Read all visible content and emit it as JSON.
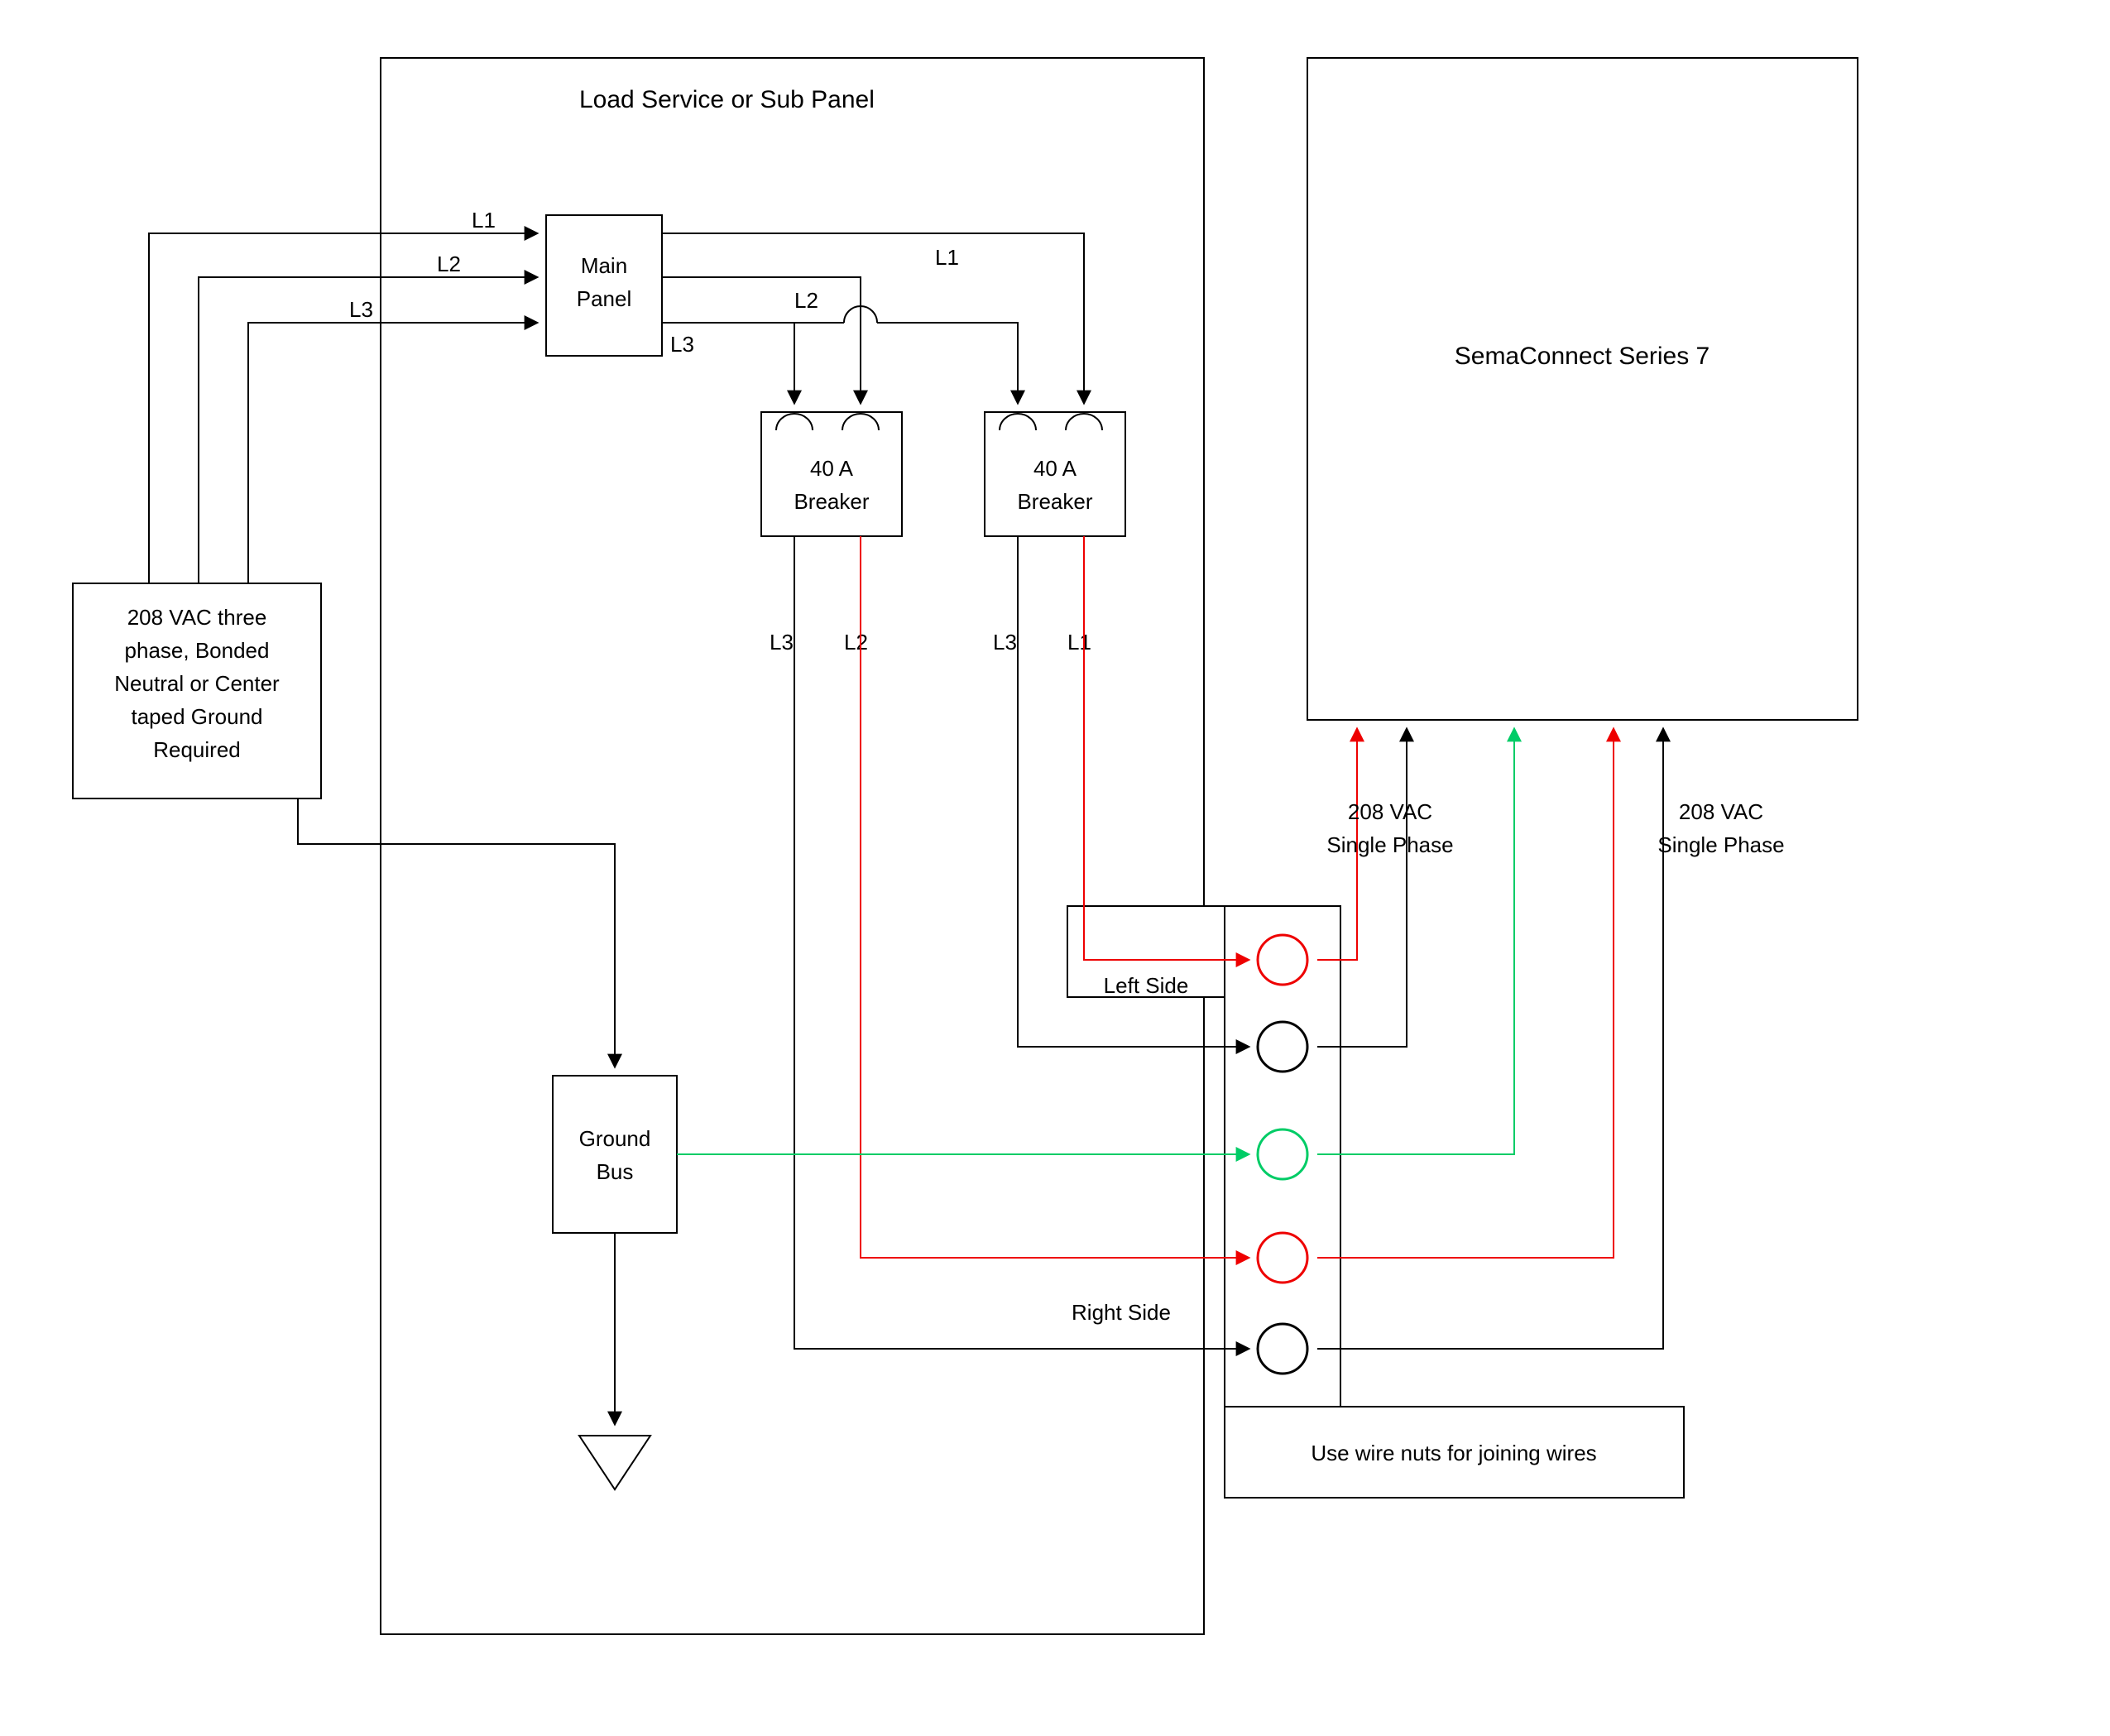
{
  "labels": {
    "load_panel_title": "Load Service or Sub Panel",
    "supply_l1": "208 VAC three",
    "supply_l2": "phase, Bonded",
    "supply_l3": "Neutral or Center",
    "supply_l4": "taped Ground",
    "supply_l5": "Required",
    "main_panel_l1": "Main",
    "main_panel_l2": "Panel",
    "breaker_l1": "40 A",
    "breaker_l2": "Breaker",
    "ground_l1": "Ground",
    "ground_l2": "Bus",
    "left_side": "Left Side",
    "right_side": "Right Side",
    "wire_nuts": "Use wire nuts for joining wires",
    "sema_title": "SemaConnect Series 7",
    "phase_a_l1": "208 VAC",
    "phase_a_l2": "Single Phase",
    "phase_b_l1": "208 VAC",
    "phase_b_l2": "Single Phase",
    "L1": "L1",
    "L2": "L2",
    "L3": "L3"
  },
  "colors": {
    "black": "#000000",
    "red": "#ee0000",
    "green": "#00cc66"
  },
  "diagram_meta": {
    "description": "Wiring diagram: 208 VAC three-phase supply feeds a Main Panel inside a Load Service or Sub Panel enclosure. Main Panel branches L1/L2/L3. Two 40 A breakers feed a junction box (Left Side / Right Side terminals, red/black/green wire nuts) which connects to a SemaConnect Series 7 charging station via two 208 VAC single-phase pairs plus ground. Ground bus tied to neutral/ground via downward arrow symbol."
  }
}
